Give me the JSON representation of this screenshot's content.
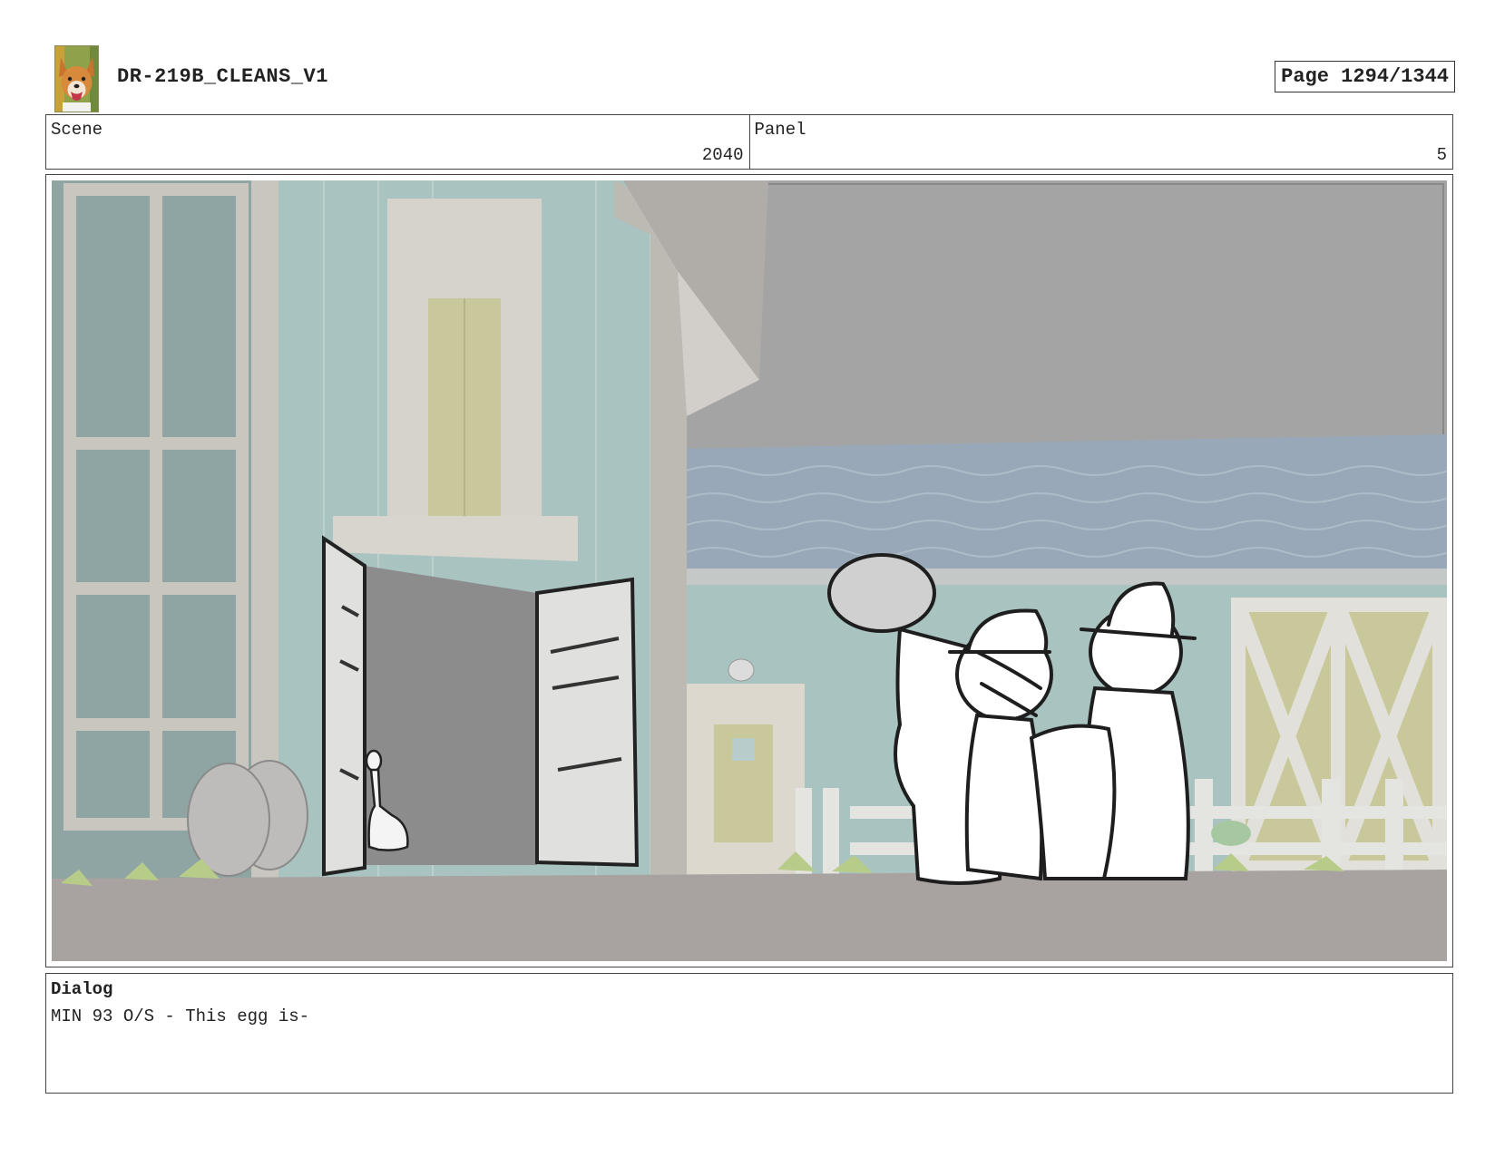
{
  "header": {
    "title": "DR-219B_CLEANS_V1",
    "page": "Page 1294/1344"
  },
  "info": {
    "scene_label": "Scene",
    "scene_value": "2040",
    "panel_label": "Panel",
    "panel_value": "5"
  },
  "dialog": {
    "label": "Dialog",
    "text": "MIN 93 O/S - This egg is-"
  },
  "icons": {
    "logo": "corgi-dog-logo-icon"
  },
  "colors": {
    "wall_teal": "#a9c3c0",
    "trim": "#c9c6c0",
    "sky_gray": "#a4a4a4",
    "roof_blue": "#98a8b8",
    "ground": "#a8a3a1",
    "door_yellow": "#c8c89a"
  }
}
